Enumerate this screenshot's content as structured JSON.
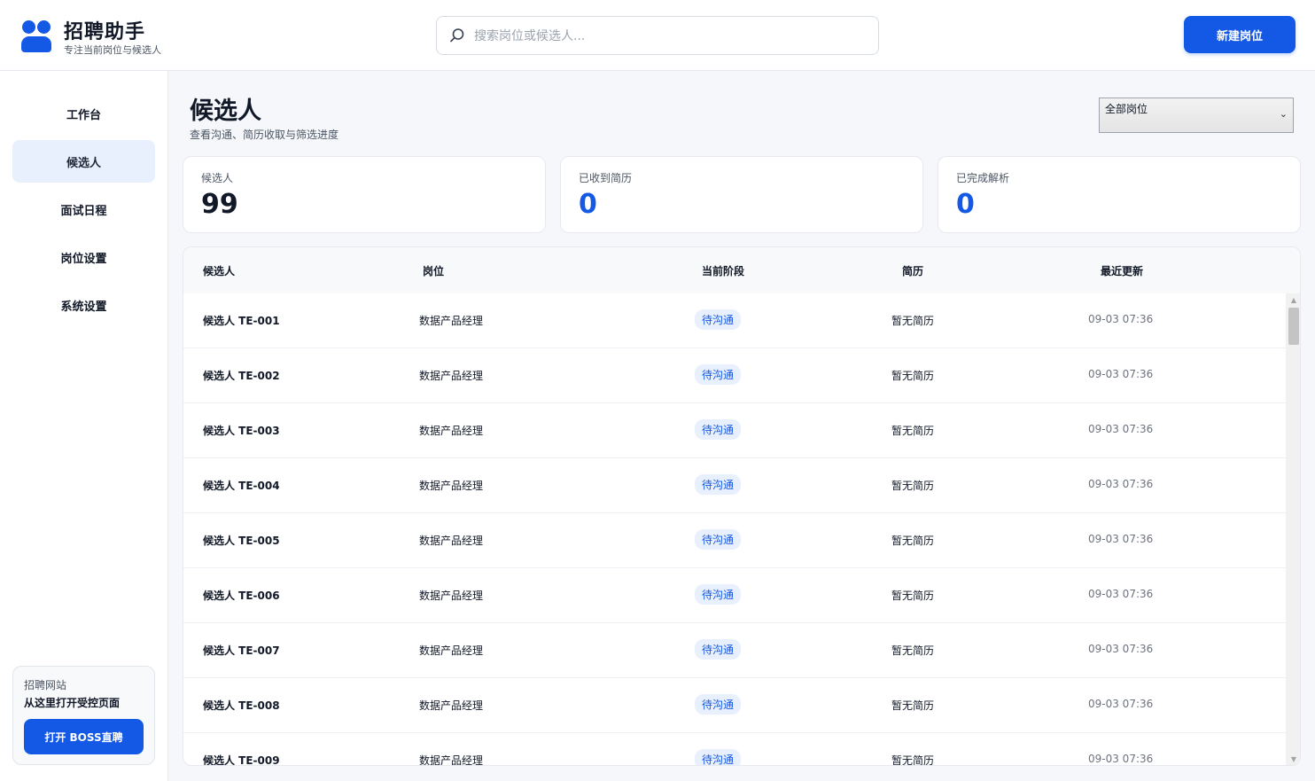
{
  "brand": {
    "title": "招聘助手",
    "subtitle": "专注当前岗位与候选人"
  },
  "search": {
    "placeholder": "搜索岗位或候选人..."
  },
  "header": {
    "new_job_label": "新建岗位"
  },
  "sidebar": {
    "items": [
      {
        "label": "工作台",
        "active": false
      },
      {
        "label": "候选人",
        "active": true
      },
      {
        "label": "面试日程",
        "active": false
      },
      {
        "label": "岗位设置",
        "active": false
      },
      {
        "label": "系统设置",
        "active": false
      }
    ],
    "promo": {
      "label": "招聘网站",
      "title": "从这里打开受控页面",
      "button": "打开 BOSS直聘"
    }
  },
  "page": {
    "title": "候选人",
    "subtitle": "查看沟通、简历收取与筛选进度"
  },
  "filter": {
    "selected": "全部岗位"
  },
  "stats": [
    {
      "label": "候选人",
      "value": "99"
    },
    {
      "label": "已收到简历",
      "value": "0"
    },
    {
      "label": "已完成解析",
      "value": "0"
    }
  ],
  "table": {
    "columns": [
      "候选人",
      "岗位",
      "当前阶段",
      "简历",
      "最近更新"
    ],
    "rows": [
      {
        "name": "候选人 TE-001",
        "job": "数据产品经理",
        "stage": "待沟通",
        "resume": "暂无简历",
        "updated": "09-03 07:36"
      },
      {
        "name": "候选人 TE-002",
        "job": "数据产品经理",
        "stage": "待沟通",
        "resume": "暂无简历",
        "updated": "09-03 07:36"
      },
      {
        "name": "候选人 TE-003",
        "job": "数据产品经理",
        "stage": "待沟通",
        "resume": "暂无简历",
        "updated": "09-03 07:36"
      },
      {
        "name": "候选人 TE-004",
        "job": "数据产品经理",
        "stage": "待沟通",
        "resume": "暂无简历",
        "updated": "09-03 07:36"
      },
      {
        "name": "候选人 TE-005",
        "job": "数据产品经理",
        "stage": "待沟通",
        "resume": "暂无简历",
        "updated": "09-03 07:36"
      },
      {
        "name": "候选人 TE-006",
        "job": "数据产品经理",
        "stage": "待沟通",
        "resume": "暂无简历",
        "updated": "09-03 07:36"
      },
      {
        "name": "候选人 TE-007",
        "job": "数据产品经理",
        "stage": "待沟通",
        "resume": "暂无简历",
        "updated": "09-03 07:36"
      },
      {
        "name": "候选人 TE-008",
        "job": "数据产品经理",
        "stage": "待沟通",
        "resume": "暂无简历",
        "updated": "09-03 07:36"
      },
      {
        "name": "候选人 TE-009",
        "job": "数据产品经理",
        "stage": "待沟通",
        "resume": "暂无简历",
        "updated": "09-03 07:36"
      }
    ]
  }
}
